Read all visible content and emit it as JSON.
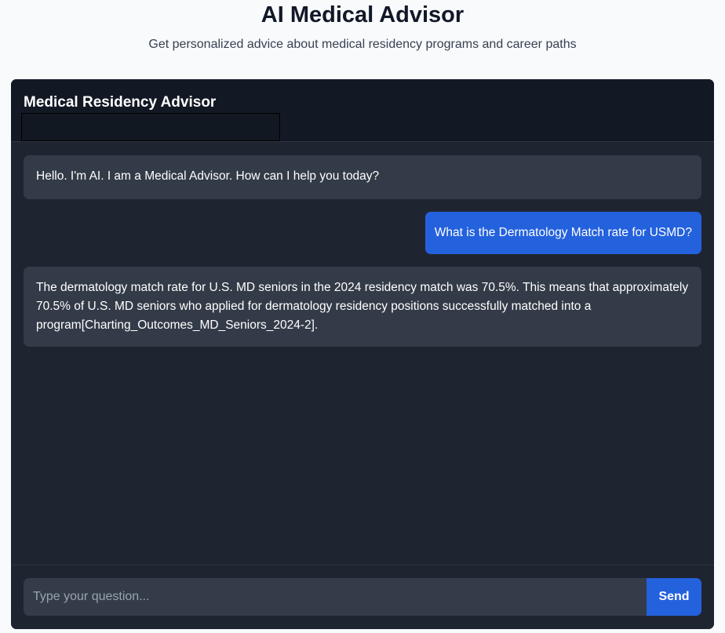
{
  "page": {
    "title": "AI Medical Advisor",
    "subtitle": "Get personalized advice about medical residency programs and career paths"
  },
  "chat": {
    "header_title": "Medical Residency Advisor",
    "messages": [
      {
        "role": "assistant",
        "text": "Hello. I'm AI. I am a Medical Advisor. How can I help you today?"
      },
      {
        "role": "user",
        "text": "What is the Dermatology Match rate for USMD?"
      },
      {
        "role": "assistant",
        "text": "The dermatology match rate for U.S. MD seniors in the 2024 residency match was 70.5%. This means that approximately 70.5% of U.S. MD seniors who applied for dermatology residency positions successfully matched into a program[Charting_Outcomes_MD_Seniors_2024-2]."
      }
    ]
  },
  "input": {
    "placeholder": "Type your question...",
    "value": "",
    "send_label": "Send"
  },
  "colors": {
    "accent": "#2461dd",
    "card_bg": "#1f2530",
    "header_bg": "#131924",
    "bubble_bg": "#333b48"
  }
}
